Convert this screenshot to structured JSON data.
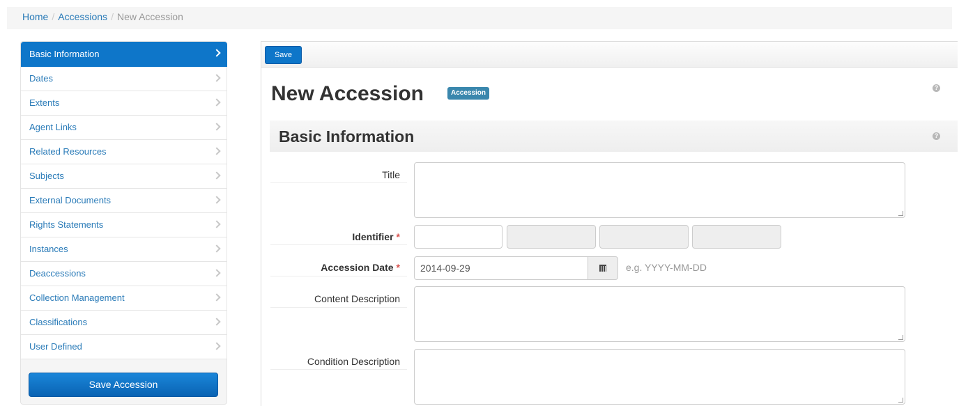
{
  "breadcrumb": {
    "home": "Home",
    "accessions": "Accessions",
    "current": "New Accession"
  },
  "sidebar": {
    "items": [
      {
        "label": "Basic Information"
      },
      {
        "label": "Dates"
      },
      {
        "label": "Extents"
      },
      {
        "label": "Agent Links"
      },
      {
        "label": "Related Resources"
      },
      {
        "label": "Subjects"
      },
      {
        "label": "External Documents"
      },
      {
        "label": "Rights Statements"
      },
      {
        "label": "Instances"
      },
      {
        "label": "Deaccessions"
      },
      {
        "label": "Collection Management"
      },
      {
        "label": "Classifications"
      },
      {
        "label": "User Defined"
      }
    ],
    "save_label": "Save Accession"
  },
  "toolbar": {
    "save_label": "Save"
  },
  "page": {
    "title": "New Accession",
    "badge": "Accession"
  },
  "section": {
    "title": "Basic Information"
  },
  "form": {
    "title_label": "Title",
    "identifier_label": "Identifier",
    "accession_date_label": "Accession Date",
    "accession_date_value": "2014-09-29",
    "date_hint": "e.g. YYYY-MM-DD",
    "content_description_label": "Content Description",
    "condition_description_label": "Condition Description",
    "required_mark": "*"
  },
  "colors": {
    "primary": "#0e76c9",
    "badge": "#3a87ad",
    "required": "#d9534f"
  }
}
